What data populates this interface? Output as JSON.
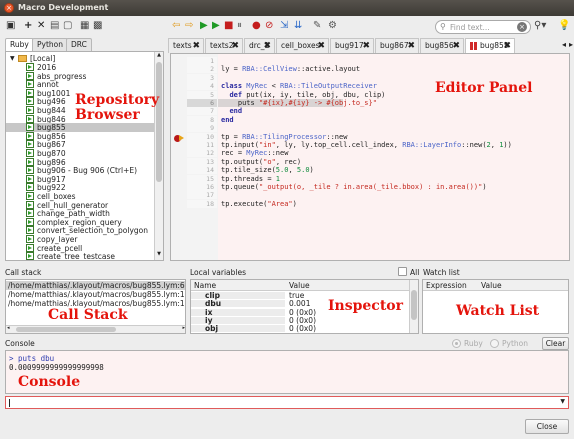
{
  "window": {
    "title": "Macro Development"
  },
  "toolbar": {
    "search_placeholder": "Find text...",
    "icons": [
      "new-macro-icon",
      "add-icon",
      "delete-icon",
      "rename-icon",
      "import-icon",
      "export-icon",
      "save-icon",
      "back-icon",
      "forward-icon",
      "run-icon",
      "run-from-here-icon",
      "stop-icon",
      "pause-icon",
      "breakpoint-icon",
      "clear-breakpoints-icon",
      "single-step-icon",
      "next-step-icon",
      "edit-icon",
      "properties-icon",
      "help-icon"
    ]
  },
  "left_tabs": [
    "Ruby",
    "Python",
    "DRC"
  ],
  "repository": {
    "root": "[Local]",
    "items": [
      "2016",
      "abs_progress",
      "annot",
      "bug1001",
      "bug496",
      "bug844",
      "bug846",
      "bug855",
      "bug856",
      "bug867",
      "bug870",
      "bug896",
      "bug906 - Bug 906 (Ctrl+E)",
      "bug917",
      "bug922",
      "cell_boxes",
      "cell_hull_generator",
      "change_path_width",
      "complex_region_query",
      "convert_selection_to_polygon",
      "copy_layer",
      "create_pcell",
      "create_tree_testcase"
    ],
    "selected": "bug855"
  },
  "editor_tabs": [
    "texts",
    "texts2",
    "drc_1",
    "cell_boxes",
    "bug917",
    "bug867",
    "bug856",
    "bug855"
  ],
  "editor": {
    "line_numbers": [
      "1",
      "2",
      "3",
      "4",
      "5",
      "6",
      "7",
      "8",
      "9",
      "10",
      "11",
      "12",
      "13",
      "14",
      "15",
      "16",
      "17",
      "18"
    ],
    "lines": [
      "",
      "ly = RBA::CellView::active.layout",
      "",
      "class MyRec < RBA::TileOutputReceiver",
      "  def put(ix, iy, tile, obj, dbu, clip)",
      "    puts \"#{ix},#{iy} -> #{obj.to_s}\"",
      "  end",
      "end",
      "",
      "tp = RBA::TilingProcessor::new",
      "tp.input(\"in\", ly, ly.top_cell.cell_index, RBA::LayerInfo::new(2, 1))",
      "rec = MyRec::new",
      "tp.output(\"o\", rec)",
      "tp.tile_size(5.0, 5.0)",
      "tp.threads = 1",
      "tp.queue(\"_output(o, _tile ? in.area(_tile.bbox) : in.area())\")",
      "",
      "tp.execute(\"Area\")"
    ]
  },
  "call_stack": {
    "label": "Call stack",
    "rows": [
      "/home/matthias/.klayout/macros/bug855.lym:6",
      "/home/matthias/.klayout/macros/bug855.lym:18:in `ex",
      "/home/matthias/.klayout/macros/bug855.lym:18:in `<m"
    ]
  },
  "locals": {
    "label": "Local variables",
    "all_label": "All",
    "headers": [
      "Name",
      "Value"
    ],
    "rows": [
      {
        "name": "clip",
        "value": "true"
      },
      {
        "name": "dbu",
        "value": "0.001"
      },
      {
        "name": "ix",
        "value": "0 (0x0)"
      },
      {
        "name": "iy",
        "value": "0 (0x0)"
      },
      {
        "name": "obj",
        "value": "0 (0x0)"
      }
    ]
  },
  "watch": {
    "label": "Watch list",
    "headers": [
      "Expression",
      "Value"
    ]
  },
  "console": {
    "label": "Console",
    "ruby_label": "Ruby",
    "python_label": "Python",
    "clear_label": "Clear",
    "lines": [
      "> puts dbu",
      "0.0009999999999999998"
    ]
  },
  "close_label": "Close",
  "annotations": {
    "repo": "Repository\nBrowser",
    "editor": "Editor Panel",
    "inspector": "Inspector",
    "callstack": "Call Stack",
    "watch": "Watch List",
    "console": "Console"
  },
  "colors": {
    "annotation": "#e4140c",
    "editor_bg": "#fdf2f2",
    "breakpoint": "#b91818",
    "exec_arrow": "#e8a418"
  }
}
